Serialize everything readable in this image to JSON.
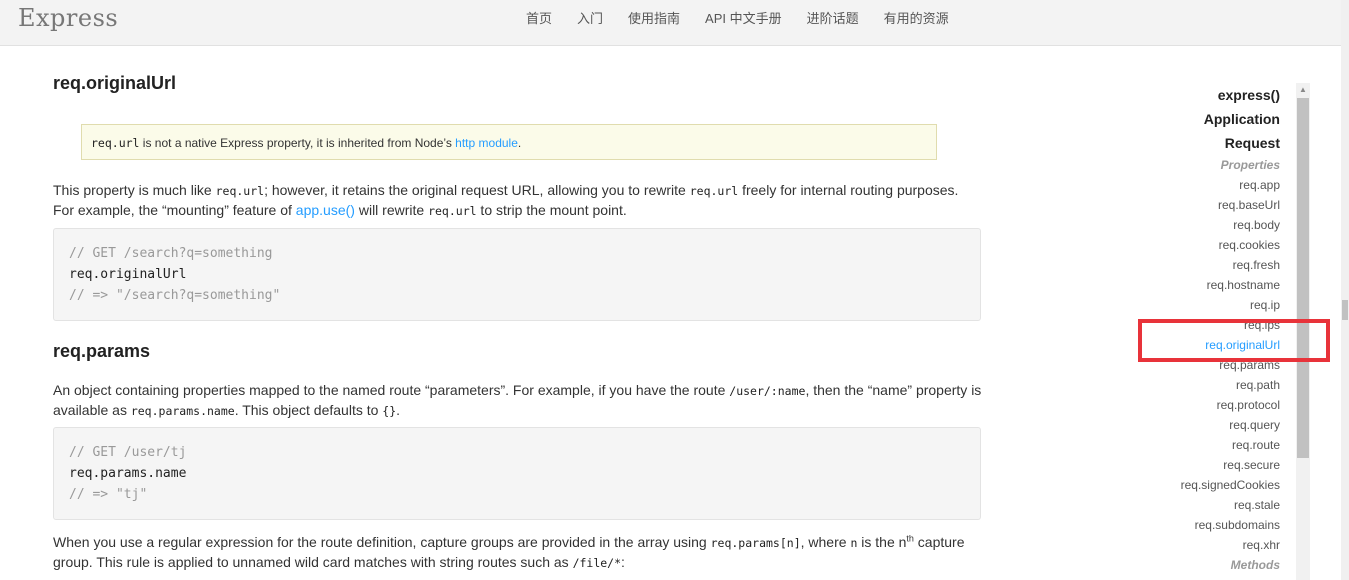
{
  "header": {
    "logo": "Express",
    "nav": [
      "首页",
      "入门",
      "使用指南",
      "API 中文手册",
      "进阶话题",
      "有用的资源"
    ]
  },
  "content": {
    "h_original_url": "req.originalUrl",
    "note": {
      "code": "req.url",
      "text": " is not a native Express property, it is inherited from Node’s ",
      "link": "http module",
      "end": "."
    },
    "p1": {
      "a": "This property is much like ",
      "code1": "req.url",
      "b": "; however, it retains the original request URL, allowing you to rewrite ",
      "code2": "req.url",
      "c": " freely for internal routing purposes. For example, the “mounting” feature of ",
      "link": "app.use()",
      "d": " will rewrite ",
      "code3": "req.url",
      "e": " to strip the mount point."
    },
    "code1": [
      "// GET /search?q=something",
      "req.originalUrl",
      "// => \"/search?q=something\""
    ],
    "h_params": "req.params",
    "p2": {
      "a": "An object containing properties mapped to the named route “parameters”. For example, if you have the route ",
      "code1": "/user/:name",
      "b": ", then the “name” property is available as ",
      "code2": "req.params.name",
      "c": ". This object defaults to ",
      "code3": "{}",
      "d": "."
    },
    "code2": [
      "// GET /user/tj",
      "req.params.name",
      "// => \"tj\""
    ],
    "p3": {
      "a": "When you use a regular expression for the route definition, capture groups are provided in the array using ",
      "code1": "req.params[n]",
      "b": ", where ",
      "code2": "n",
      "c": " is the n",
      "sup": "th",
      "d": " capture group. This rule is applied to unnamed wild card matches with string routes such as ",
      "code3": "/file/*",
      "e": ":"
    }
  },
  "sidebar": {
    "express": "express()",
    "application": "Application",
    "request": "Request",
    "properties": "Properties",
    "items": [
      "req.app",
      "req.baseUrl",
      "req.body",
      "req.cookies",
      "req.fresh",
      "req.hostname",
      "req.ip",
      "req.ips",
      "req.originalUrl",
      "req.params",
      "req.path",
      "req.protocol",
      "req.query",
      "req.route",
      "req.secure",
      "req.signedCookies",
      "req.stale",
      "req.subdomains",
      "req.xhr"
    ],
    "methods": "Methods",
    "active_index": 8
  },
  "colors": {
    "link": "#259dff",
    "highlight": "#e8333a",
    "note_bg": "#fbfbe9"
  }
}
